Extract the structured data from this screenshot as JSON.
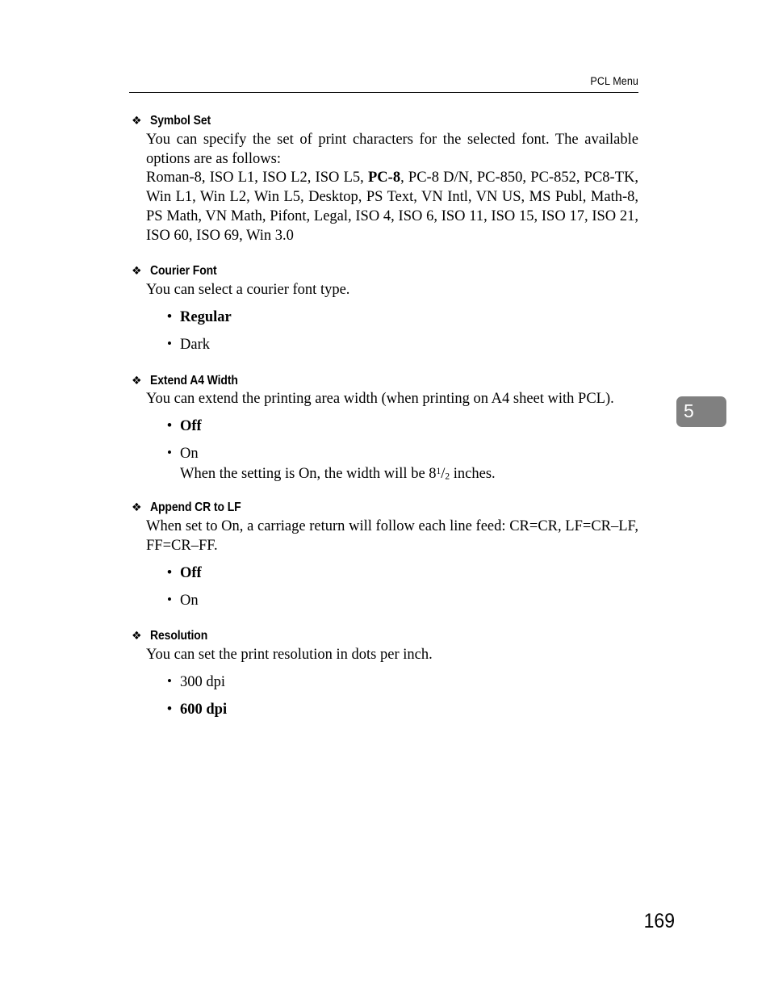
{
  "header": {
    "title": "PCL Menu"
  },
  "chapter_tab": {
    "number": "5"
  },
  "folio": {
    "page_number": "169"
  },
  "bullets": {
    "section_marker": "❖",
    "option_marker": "•"
  },
  "sections": [
    {
      "id": "symbol-set",
      "title": "Symbol Set",
      "paragraphs": [
        "You can specify the set of print characters for the selected font. The available options are as follows:"
      ],
      "option_list_inline": {
        "before": "Roman-8, ISO L1, ISO L2, ISO L5, ",
        "default": "PC-8",
        "after": ", PC-8 D/N, PC-850, PC-852, PC8-TK, Win L1, Win L2, Win L5, Desktop, PS Text, VN Intl, VN US, MS Publ, Math-8, PS Math, VN Math, Pifont, Legal, ISO 4, ISO 6, ISO 11, ISO 15, ISO 17, ISO 21, ISO 60, ISO 69, Win 3.0"
      }
    },
    {
      "id": "courier-font",
      "title": "Courier Font",
      "paragraphs": [
        "You can select a courier font type."
      ],
      "options": [
        {
          "label": "Regular",
          "default": true
        },
        {
          "label": "Dark",
          "default": false
        }
      ]
    },
    {
      "id": "extend-a4-width",
      "title": "Extend A4 Width",
      "paragraphs": [
        "You can extend the printing area width (when printing on A4 sheet with PCL)."
      ],
      "options": [
        {
          "label": "Off",
          "default": true
        },
        {
          "label": "On",
          "default": false,
          "note_before": "When the setting is On, the width will be 8",
          "note_numerator": "1",
          "note_slash": "/",
          "note_denominator": "2",
          "note_after": " inches."
        }
      ]
    },
    {
      "id": "append-cr-to-lf",
      "title": "Append CR to LF",
      "paragraphs": [
        "When set to On, a carriage return will follow each line feed: CR=CR, LF=CR–LF, FF=CR–FF."
      ],
      "options": [
        {
          "label": "Off",
          "default": true
        },
        {
          "label": "On",
          "default": false
        }
      ]
    },
    {
      "id": "resolution",
      "title": "Resolution",
      "paragraphs": [
        "You can set the print resolution in dots per inch."
      ],
      "options": [
        {
          "label": "300 dpi",
          "default": false
        },
        {
          "label": "600 dpi",
          "default": true
        }
      ]
    }
  ]
}
